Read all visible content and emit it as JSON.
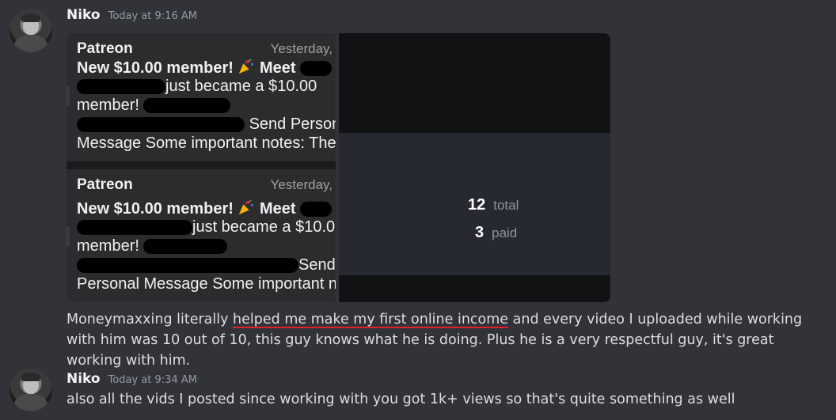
{
  "messages": [
    {
      "username": "Niko",
      "timestamp": "Today at 9:16 AM",
      "text_before": "Moneymaxxing literally ",
      "text_underlined": "helped me make my first online income",
      "text_after": " and every video I uploaded while working with him was 10 out of 10, this guy knows what he is doing. Plus he is a very respectful guy, it's great working with him."
    },
    {
      "username": "Niko",
      "timestamp": "Today at 9:34 AM",
      "text": "also all the vids I posted since working with you got 1k+ views so that's quite something as well"
    }
  ],
  "attachment1": {
    "notifications": [
      {
        "app": "Patreon",
        "when": "Yesterday,",
        "line1": "New $10.00 member!",
        "line1b": "Meet",
        "line2": "just became a $10.00",
        "line3": "member!",
        "line4": "Send Person",
        "line5": "Message Some important notes: The"
      },
      {
        "app": "Patreon",
        "when": "Yesterday,",
        "line1": "New $10.00 member!",
        "line1b": "Meet",
        "line2": "just became a $10.0",
        "line3": "member!",
        "line4": "Send",
        "line5": "Personal Message Some important n"
      }
    ]
  },
  "attachment2": {
    "stats": [
      {
        "value": "12",
        "label": "total"
      },
      {
        "value": "3",
        "label": "paid"
      }
    ]
  },
  "colors": {
    "background": "#313338",
    "username": "#f2f3f5",
    "timestamp": "#949ba4",
    "underline": "#e0202a"
  }
}
